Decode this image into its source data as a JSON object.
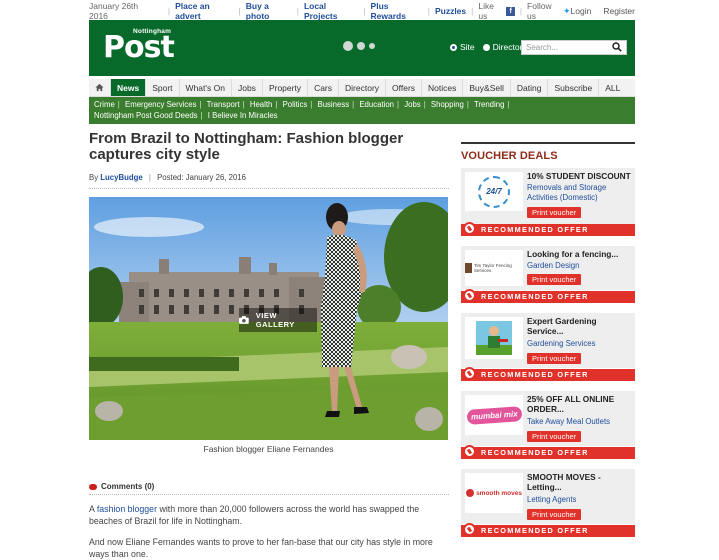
{
  "topbar": {
    "date": "January 26th 2016",
    "links": [
      "Place an advert",
      "Buy a photo",
      "Local Projects",
      "Plus Rewards",
      "Puzzles"
    ],
    "like_us": "Like us",
    "follow_us": "Follow us",
    "login": "Login",
    "register": "Register"
  },
  "header": {
    "logo_small": "Nottingham",
    "logo_big": "Post",
    "radio_site": "Site",
    "radio_directory": "Directory",
    "search_placeholder": "Search..."
  },
  "nav": [
    "News",
    "Sport",
    "What's On",
    "Jobs",
    "Property",
    "Cars",
    "Directory",
    "Offers",
    "Notices",
    "Buy&Sell",
    "Dating",
    "Subscribe",
    "ALL"
  ],
  "subnav": [
    "Crime",
    "Emergency Services",
    "Transport",
    "Health",
    "Politics",
    "Business",
    "Education",
    "Jobs",
    "Shopping",
    "Trending",
    "Nottingham Post Good Deeds",
    "I Believe In Miracles"
  ],
  "article": {
    "title": "From Brazil to Nottingham: Fashion blogger captures city style",
    "by": "By",
    "author": "LucyBudge",
    "posted": "Posted: January 26, 2016",
    "gallery": "VIEW GALLERY",
    "caption": "Fashion blogger Eliane Fernandes",
    "comments": "Comments (0)",
    "p1_a": "A",
    "p1_link": "fashion blogger",
    "p1_b": "with more than 20,000 followers across the world has swapped the beaches of Brazil for life in Nottingham.",
    "p2": "And now Eliane Fernandes wants to prove to her fan-base that our city has style in more ways than one."
  },
  "sidebar": {
    "heading": "VOUCHER DEALS",
    "ribbon": "RECOMMENDED OFFER",
    "button": "Print voucher",
    "cards": [
      {
        "name": "10% STUDENT DISCOUNT",
        "category": "Removals and Storage Activities (Domestic)",
        "thumb": "24/7"
      },
      {
        "name": "Looking for a fencing...",
        "category": "Garden Design",
        "thumb": "Tim Taylor Fencing Services"
      },
      {
        "name": "Expert Gardening Service...",
        "category": "Gardening Services",
        "thumb": ""
      },
      {
        "name": "25% OFF ALL ONLINE ORDER...",
        "category": "Take Away Meal Outlets",
        "thumb": "mumbai mix"
      },
      {
        "name": "SMOOTH MOVES - Letting...",
        "category": "Letting Agents",
        "thumb": "smooth moves"
      }
    ]
  },
  "colors": {
    "brand_green": "#086a2a",
    "subnav_green": "#3b7d2e",
    "link_blue": "#1f4e9a",
    "offer_red": "#e0322a"
  }
}
